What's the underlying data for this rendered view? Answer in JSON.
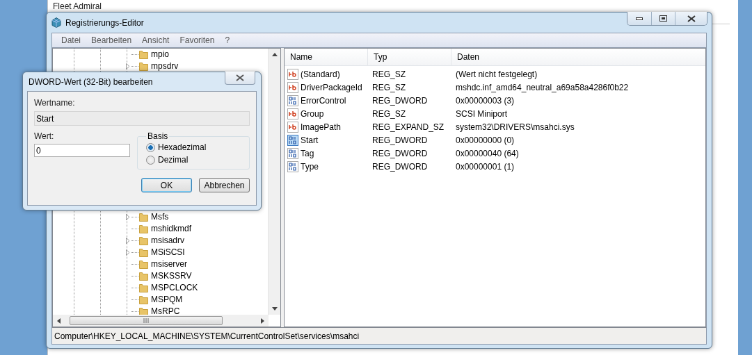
{
  "background_page": {
    "user_rank": "Fleet Admiral"
  },
  "window": {
    "title": "Registrierungs-Editor"
  },
  "menu": [
    "Datei",
    "Bearbeiten",
    "Ansicht",
    "Favoriten",
    "?"
  ],
  "tree": {
    "items_above": [
      {
        "label": "mpio",
        "expandable": false
      },
      {
        "label": "mpsdrv",
        "expandable": true
      }
    ],
    "items_below": [
      {
        "label": "Msfs",
        "expandable": true
      },
      {
        "label": "mshidkmdf",
        "expandable": false
      },
      {
        "label": "msisadrv",
        "expandable": true
      },
      {
        "label": "MSiSCSI",
        "expandable": true
      },
      {
        "label": "msiserver",
        "expandable": false
      },
      {
        "label": "MSKSSRV",
        "expandable": false
      },
      {
        "label": "MSPCLOCK",
        "expandable": false
      },
      {
        "label": "MSPQM",
        "expandable": false
      },
      {
        "label": "MsRPC",
        "expandable": false
      }
    ]
  },
  "table": {
    "columns": [
      "Name",
      "Typ",
      "Daten"
    ],
    "rows": [
      {
        "kind": "string",
        "name": "(Standard)",
        "type": "REG_SZ",
        "data": "(Wert nicht festgelegt)",
        "selected": false
      },
      {
        "kind": "string",
        "name": "DriverPackageId",
        "type": "REG_SZ",
        "data": "mshdc.inf_amd64_neutral_a69a58a4286f0b22",
        "selected": false
      },
      {
        "kind": "binary",
        "name": "ErrorControl",
        "type": "REG_DWORD",
        "data": "0x00000003 (3)",
        "selected": false
      },
      {
        "kind": "string",
        "name": "Group",
        "type": "REG_SZ",
        "data": "SCSI Miniport",
        "selected": false
      },
      {
        "kind": "string",
        "name": "ImagePath",
        "type": "REG_EXPAND_SZ",
        "data": "system32\\DRIVERS\\msahci.sys",
        "selected": false
      },
      {
        "kind": "binary",
        "name": "Start",
        "type": "REG_DWORD",
        "data": "0x00000000 (0)",
        "selected": true
      },
      {
        "kind": "binary",
        "name": "Tag",
        "type": "REG_DWORD",
        "data": "0x00000040 (64)",
        "selected": false
      },
      {
        "kind": "binary",
        "name": "Type",
        "type": "REG_DWORD",
        "data": "0x00000001 (1)",
        "selected": false
      }
    ]
  },
  "status_bar": "Computer\\HKEY_LOCAL_MACHINE\\SYSTEM\\CurrentControlSet\\services\\msahci",
  "dialog": {
    "title": "DWORD-Wert (32-Bit) bearbeiten",
    "name_label": "Wertname:",
    "name_value": "Start",
    "value_label": "Wert:",
    "value": "0",
    "base_label": "Basis",
    "bases": [
      {
        "label": "Hexadezimal",
        "selected": true
      },
      {
        "label": "Dezimal",
        "selected": false
      }
    ],
    "buttons": [
      {
        "label": "OK",
        "default": true
      },
      {
        "label": "Abbrechen",
        "default": false
      }
    ]
  }
}
